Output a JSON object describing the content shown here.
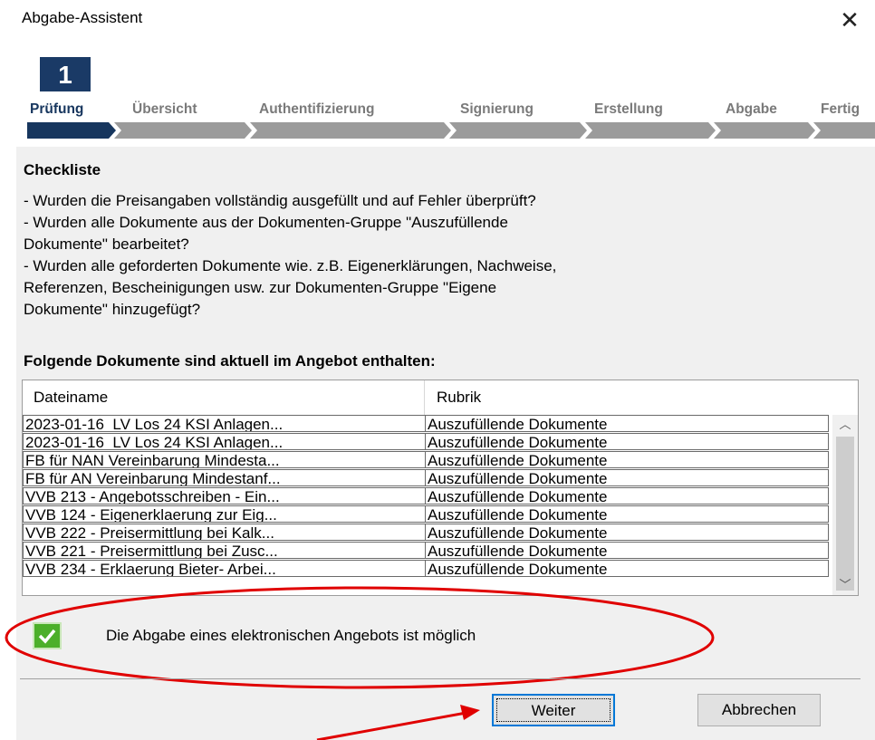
{
  "window": {
    "title": "Abgabe-Assistent",
    "close_icon": "close-icon"
  },
  "wizard": {
    "step_number": "1",
    "steps": [
      "Prüfung",
      "Übersicht",
      "Authentifizierung",
      "Signierung",
      "Erstellung",
      "Abgabe",
      "Fertig"
    ],
    "active_step": 0
  },
  "checklist": {
    "heading": "Checkliste",
    "text": "- Wurden die Preisangaben vollständig ausgefüllt und auf Fehler überprüft?\n- Wurden alle Dokumente aus der Dokumenten-Gruppe \"Auszufüllende\nDokumente\" bearbeitet?\n- Wurden alle geforderten Dokumente wie. z.B. Eigenerklärungen, Nachweise,\nReferenzen, Bescheinigungen usw. zur Dokumenten-Gruppe \"Eigene\nDokumente\" hinzugefügt?"
  },
  "documents": {
    "heading": "Folgende Dokumente sind aktuell im Angebot enthalten:",
    "columns": [
      "Dateiname",
      "Rubrik"
    ],
    "rows": [
      [
        "2023-01-16_LV Los 24 KSI Anlagen...",
        "Auszufüllende Dokumente"
      ],
      [
        "2023-01-16_LV Los 24 KSI Anlagen...",
        "Auszufüllende Dokumente"
      ],
      [
        "FB für NAN Vereinbarung Mindesta...",
        "Auszufüllende Dokumente"
      ],
      [
        "FB für AN Vereinbarung Mindestanf...",
        "Auszufüllende Dokumente"
      ],
      [
        "VVB 213 - Angebotsschreiben - Ein...",
        "Auszufüllende Dokumente"
      ],
      [
        "VVB 124 - Eigenerklaerung zur Eig...",
        "Auszufüllende Dokumente"
      ],
      [
        "VVB 222 - Preisermittlung bei Kalk...",
        "Auszufüllende Dokumente"
      ],
      [
        "VVB 221 - Preisermittlung bei Zusc...",
        "Auszufüllende Dokumente"
      ],
      [
        "VVB 234 - Erklaerung Bieter- Arbei...",
        "Auszufüllende Dokumente"
      ]
    ],
    "scroll_up_icon": "chevron-up-icon",
    "scroll_down_icon": "chevron-down-icon"
  },
  "status": {
    "icon": "checkmark-icon",
    "text": "Die Abgabe eines elektronischen Angebots ist möglich",
    "color": "#4caf2a"
  },
  "buttons": {
    "next": "Weiter",
    "cancel": "Abbrechen"
  },
  "annotation_color": "#e00000"
}
